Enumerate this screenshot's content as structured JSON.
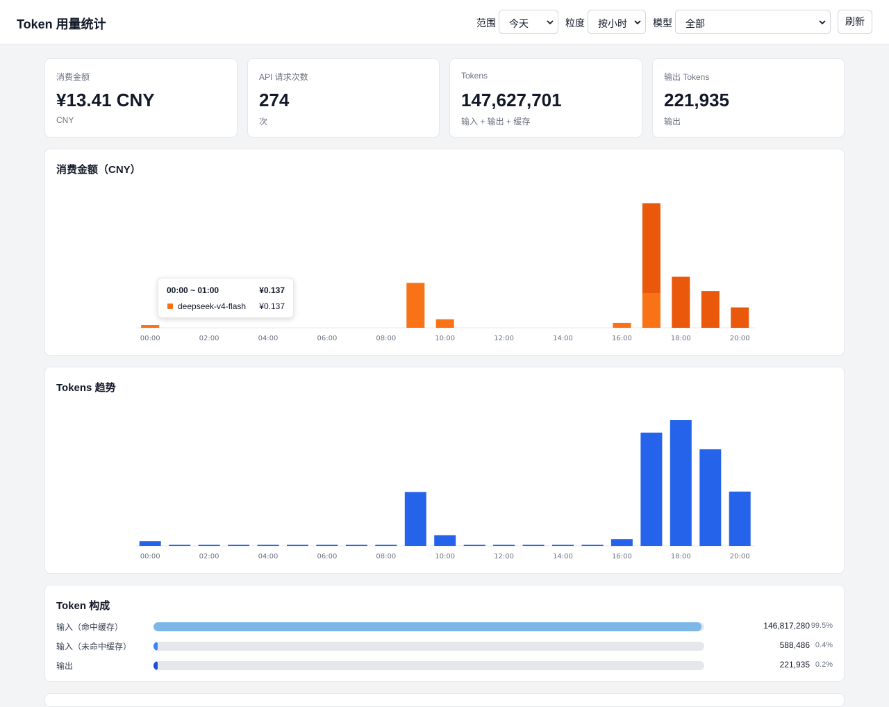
{
  "header": {
    "title": "Token 用量统计",
    "range_label": "范围",
    "range_value": "今天",
    "granularity_label": "粒度",
    "granularity_value": "按小时",
    "model_label": "模型",
    "model_value": "全部",
    "refresh_label": "刷新"
  },
  "kpis": [
    {
      "label": "消费金额",
      "value": "¥13.41 CNY",
      "sub": "CNY"
    },
    {
      "label": "API 请求次数",
      "value": "274",
      "sub": "次"
    },
    {
      "label": "Tokens",
      "value": "147,627,701",
      "sub": "输入 + 输出 + 缓存"
    },
    {
      "label": "输出 Tokens",
      "value": "221,935",
      "sub": "输出"
    }
  ],
  "cost_panel": {
    "title": "消费金额（CNY）"
  },
  "tokens_panel": {
    "title": "Tokens 趋势"
  },
  "tooltip": {
    "time": "00:00 ~ 01:00",
    "total": "¥0.137",
    "series_name": "deepseek-v4-flash",
    "series_value": "¥0.137"
  },
  "composition": {
    "title": "Token 构成",
    "rows": [
      {
        "label": "输入（命中缓存）",
        "value": "146,817,280",
        "pct": "99.5%",
        "fraction": 0.995,
        "color": "#7cb7e8"
      },
      {
        "label": "输入（未命中缓存）",
        "value": "588,486",
        "pct": "0.4%",
        "fraction": 0.004,
        "color": "#3b82f6"
      },
      {
        "label": "输出",
        "value": "221,935",
        "pct": "0.2%",
        "fraction": 0.002,
        "color": "#1d4ed8"
      }
    ]
  },
  "chart_data": [
    {
      "type": "bar",
      "title": "消费金额（CNY）",
      "categories": [
        "00:00",
        "01:00",
        "02:00",
        "03:00",
        "04:00",
        "05:00",
        "06:00",
        "07:00",
        "08:00",
        "09:00",
        "10:00",
        "11:00",
        "12:00",
        "13:00",
        "14:00",
        "15:00",
        "16:00",
        "17:00",
        "18:00",
        "19:00",
        "20:00"
      ],
      "x_tick_labels": [
        "00:00",
        "02:00",
        "04:00",
        "06:00",
        "08:00",
        "10:00",
        "12:00",
        "14:00",
        "16:00",
        "18:00",
        "20:00"
      ],
      "stacked": true,
      "series": [
        {
          "color": "#f97316",
          "values": [
            0.137,
            0,
            0,
            0,
            0,
            0,
            0,
            0,
            0,
            2.2,
            0.42,
            0,
            0,
            0,
            0,
            0,
            0.24,
            1.7,
            0,
            0,
            0
          ]
        },
        {
          "color": "#ea580c",
          "values": [
            0,
            0,
            0,
            0,
            0,
            0,
            0,
            0,
            0,
            0,
            0,
            0,
            0,
            0,
            0,
            0,
            0,
            4.4,
            2.5,
            1.8,
            1.0
          ]
        }
      ],
      "ylim": [
        0,
        6.7
      ],
      "grid": false
    },
    {
      "type": "bar",
      "title": "Tokens 趋势",
      "categories": [
        "00:00",
        "01:00",
        "02:00",
        "03:00",
        "04:00",
        "05:00",
        "06:00",
        "07:00",
        "08:00",
        "09:00",
        "10:00",
        "11:00",
        "12:00",
        "13:00",
        "14:00",
        "15:00",
        "16:00",
        "17:00",
        "18:00",
        "19:00",
        "20:00"
      ],
      "x_tick_labels": [
        "00:00",
        "02:00",
        "04:00",
        "06:00",
        "08:00",
        "10:00",
        "12:00",
        "14:00",
        "16:00",
        "18:00",
        "20:00"
      ],
      "series": [
        {
          "color": "#2563eb",
          "values": [
            1.1,
            0.1,
            0.1,
            0.1,
            0.1,
            0.1,
            0.1,
            0.1,
            0.1,
            12.6,
            2.5,
            0.1,
            0.1,
            0.1,
            0.1,
            0.1,
            1.6,
            26.5,
            29.4,
            22.6,
            12.7
          ]
        }
      ],
      "ylim": [
        0,
        32
      ],
      "grid": false
    }
  ]
}
